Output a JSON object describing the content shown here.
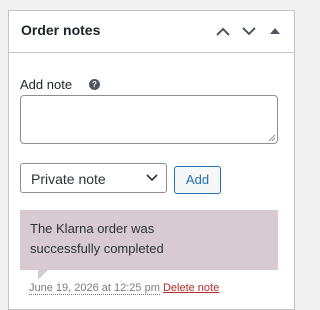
{
  "panel": {
    "title": "Order notes"
  },
  "form": {
    "add_note_label": "Add note",
    "help_glyph": "?",
    "note_value": "",
    "note_type_selected": "Private note",
    "add_button_label": "Add"
  },
  "notes": [
    {
      "content": "The Klarna order was successfully completed",
      "date": "June 19, 2026 at 12:25 pm",
      "delete_label": "Delete note"
    }
  ],
  "icons": {
    "move_up": "chevron-up-icon",
    "move_down": "chevron-down-icon",
    "toggle": "caret-up-icon",
    "help": "help-icon"
  },
  "colors": {
    "note_background": "#d7cad2",
    "link_blue": "#2271b1",
    "delete_red": "#b32d2e"
  }
}
